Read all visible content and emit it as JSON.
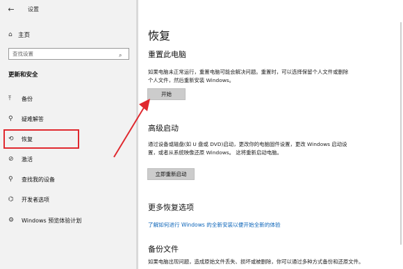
{
  "app": {
    "title": "设置",
    "back_glyph": "←"
  },
  "sidebar": {
    "home": {
      "icon": "home-icon",
      "glyph": "⌂",
      "label": "主页"
    },
    "search": {
      "placeholder": "查找设置",
      "icon": "search-icon",
      "glyph": "⌕"
    },
    "section_title": "更新和安全",
    "items": [
      {
        "name": "backup",
        "icon": "backup-arrow-icon",
        "glyph": "⤒",
        "label": "备份"
      },
      {
        "name": "troubleshoot",
        "icon": "wrench-icon",
        "glyph": "⚲",
        "label": "疑难解答"
      },
      {
        "name": "recovery",
        "icon": "history-icon",
        "glyph": "⟲",
        "label": "恢复"
      },
      {
        "name": "activation",
        "icon": "check-circle-icon",
        "glyph": "⊘",
        "label": "激活"
      },
      {
        "name": "find-my-device",
        "icon": "person-location-icon",
        "glyph": "⚲",
        "label": "查找我的设备"
      },
      {
        "name": "developer",
        "icon": "developer-icon",
        "glyph": "⌬",
        "label": "开发者选项"
      },
      {
        "name": "insider",
        "icon": "insider-icon",
        "glyph": "⚙",
        "label": "Windows 预览体验计划"
      }
    ]
  },
  "main": {
    "title": "恢复",
    "reset": {
      "heading": "重置此电脑",
      "description": "如果电脑未正常运行，重置电脑可能会解决问题。重置时，可以选择保留个人文件或删除个人文件，然后重新安装 Windows。",
      "button": "开始"
    },
    "advanced": {
      "heading": "高级启动",
      "description": "通过设备或磁盘(如 U 盘或 DVD)启动，更改你的电脑固件设置，更改 Windows 启动设置，或者从系统映像还原 Windows。 这将重新启动电脑。",
      "button": "立即重新启动"
    },
    "more": {
      "heading": "更多恢复选项",
      "link": "了解如何进行 Windows 的全新安装以便开始全新的体验"
    },
    "backup": {
      "heading": "备份文件",
      "description": "如果电脑出现问题，造成原始文件丢失、损坏或被删除，你可以通过多种方式备份和还原文件。"
    }
  },
  "colors": {
    "highlight": "#e0282e",
    "link": "#0a63b8",
    "button": "#cccccc",
    "sidebar_bg": "#f2f2f2"
  }
}
